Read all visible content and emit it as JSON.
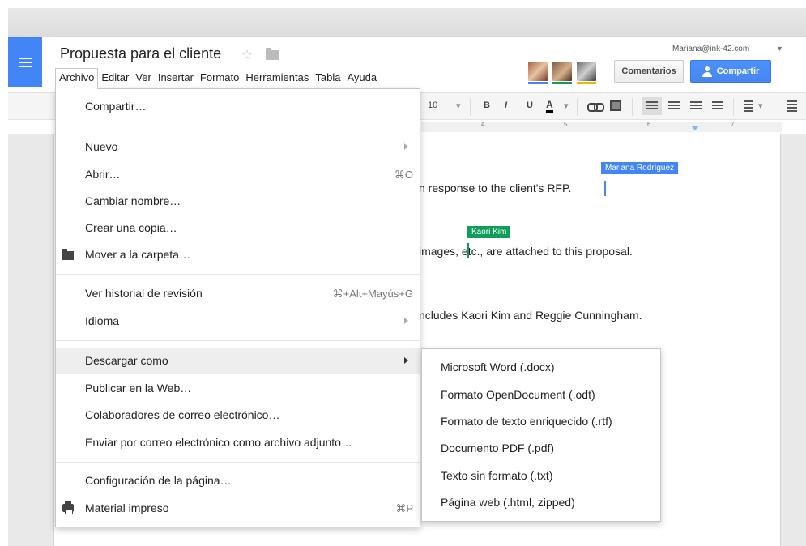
{
  "document": {
    "title": "Propuesta para el cliente",
    "account": "Mariana@ink-42.com"
  },
  "menubar": [
    "Archivo",
    "Editar",
    "Ver",
    "Insertar",
    "Formato",
    "Herramientas",
    "Tabla",
    "Ayuda"
  ],
  "header": {
    "comments_label": "Comentarios",
    "share_label": "Compartir",
    "collaborator_colors": [
      "#4285f4",
      "#0f9d58",
      "#f4b400"
    ]
  },
  "toolbar": {
    "font_size": "10",
    "bold": "B",
    "italic": "I",
    "underline": "U",
    "text_color": "A"
  },
  "ruler": {
    "ticks": [
      "4",
      "5",
      "6",
      "7"
    ]
  },
  "doc_body": {
    "line1": "n response to the client's RFP.",
    "line2": "images, etc., are attached to this proposal.",
    "line3": "ncludes Kaori Kim and Reggie Cunningham."
  },
  "cursors": [
    {
      "name": "Mariana Rodríguez",
      "color": "#4285f4"
    },
    {
      "name": "Kaori Kim",
      "color": "#0f9d58"
    }
  ],
  "file_menu": {
    "share": "Compartir…",
    "new": "Nuevo",
    "open": "Abrir…",
    "open_shortcut": "⌘O",
    "rename": "Cambiar nombre…",
    "copy": "Crear una copia…",
    "move": "Mover a la carpeta…",
    "history": "Ver historial de revisión",
    "history_shortcut": "⌘+Alt+Mayús+G",
    "language": "Idioma",
    "download": "Descargar como",
    "publish": "Publicar en la Web…",
    "email_collaborators": "Colaboradores de correo electrónico…",
    "email_attachment": "Enviar por correo electrónico como archivo adjunto…",
    "page_setup": "Configuración de la página…",
    "print": "Material impreso",
    "print_shortcut": "⌘P"
  },
  "download_submenu": [
    "Microsoft Word (.docx)",
    "Formato OpenDocument (.odt)",
    "Formato de texto enriquecido (.rtf)",
    "Documento PDF (.pdf)",
    "Texto sin formato (.txt)",
    "Página web (.html, zipped)"
  ]
}
